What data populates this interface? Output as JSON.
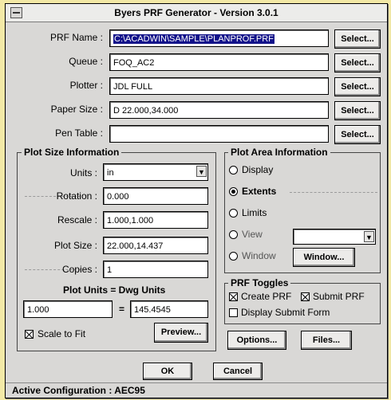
{
  "window": {
    "title": "Byers PRF Generator - Version 3.0.1"
  },
  "top_fields": {
    "prf_name": {
      "label": "PRF Name :",
      "value": "C:\\ACADWIN\\SAMPLE\\PLANPROF.PRF"
    },
    "queue": {
      "label": "Queue :",
      "value": "FOQ_AC2"
    },
    "plotter": {
      "label": "Plotter :",
      "value": "JDL FULL"
    },
    "paper_size": {
      "label": "Paper Size :",
      "value": "D 22.000,34.000"
    },
    "pen_table": {
      "label": "Pen Table :",
      "value": ""
    },
    "select_label": "Select..."
  },
  "plot_size": {
    "title": "Plot Size Information",
    "units_label": "Units :",
    "units_value": "in",
    "rotation_label": "Rotation :",
    "rotation_value": "0.000",
    "rescale_label": "Rescale :",
    "rescale_value": "1.000,1.000",
    "plot_size_label": "Plot Size :",
    "plot_size_value": "22.000,14.437",
    "copies_label": "Copies :",
    "copies_value": "1",
    "plot_units_label": "Plot Units  =  Dwg Units",
    "plot_units_value": "1.000",
    "equals": "=",
    "dwg_units_value": "145.4545",
    "scale_to_fit_label": "Scale to Fit",
    "scale_to_fit_checked": true,
    "preview_label": "Preview..."
  },
  "plot_area": {
    "title": "Plot Area Information",
    "display_label": "Display",
    "extents_label": "Extents",
    "limits_label": "Limits",
    "view_label": "View",
    "window_label": "Window",
    "window_button_label": "Window...",
    "selected": "extents"
  },
  "prf_toggles": {
    "title": "PRF Toggles",
    "create_prf_label": "Create PRF",
    "create_prf_checked": true,
    "submit_prf_label": "Submit PRF",
    "submit_prf_checked": true,
    "display_submit_form_label": "Display Submit Form",
    "display_submit_form_checked": false
  },
  "buttons": {
    "options": "Options...",
    "files": "Files...",
    "ok": "OK",
    "cancel": "Cancel"
  },
  "status": {
    "active_configuration": "Active Configuration : AEC95"
  },
  "icons": {
    "system_menu": "system-menu-icon",
    "dropdown": "dropdown-arrow-icon"
  }
}
